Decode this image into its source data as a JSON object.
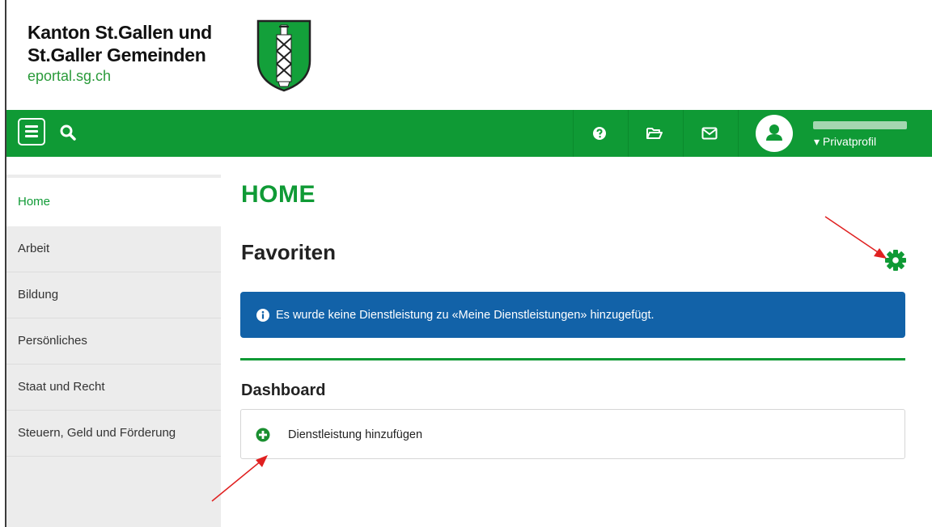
{
  "header": {
    "brand_line1": "Kanton St.Gallen und",
    "brand_line2": "St.Galler Gemeinden",
    "brand_url": "eportal.sg.ch"
  },
  "topbar": {
    "icons": [
      "menu-icon",
      "search-icon",
      "help-icon",
      "folder-icon",
      "mail-icon",
      "user-icon"
    ],
    "profile_link": "▾ Privatprofil"
  },
  "sidebar": {
    "items": [
      {
        "label": "Home",
        "active": true
      },
      {
        "label": "Arbeit"
      },
      {
        "label": "Bildung"
      },
      {
        "label": "Persönliches"
      },
      {
        "label": "Staat und Recht"
      },
      {
        "label": "Steuern, Geld und Förderung"
      }
    ]
  },
  "main": {
    "page_title": "HOME",
    "section_title": "Favoriten",
    "info_message": "Es wurde keine Dienstleistung zu «Meine Dienstleistungen» hinzugefügt.",
    "dashboard_title": "Dashboard",
    "add_service_label": "Dienstleistung hinzufügen"
  },
  "colors": {
    "brand_green": "#0f9a35",
    "info_blue": "#1262a8",
    "sidebar_bg": "#ececec",
    "annotation_red": "#e02020"
  }
}
